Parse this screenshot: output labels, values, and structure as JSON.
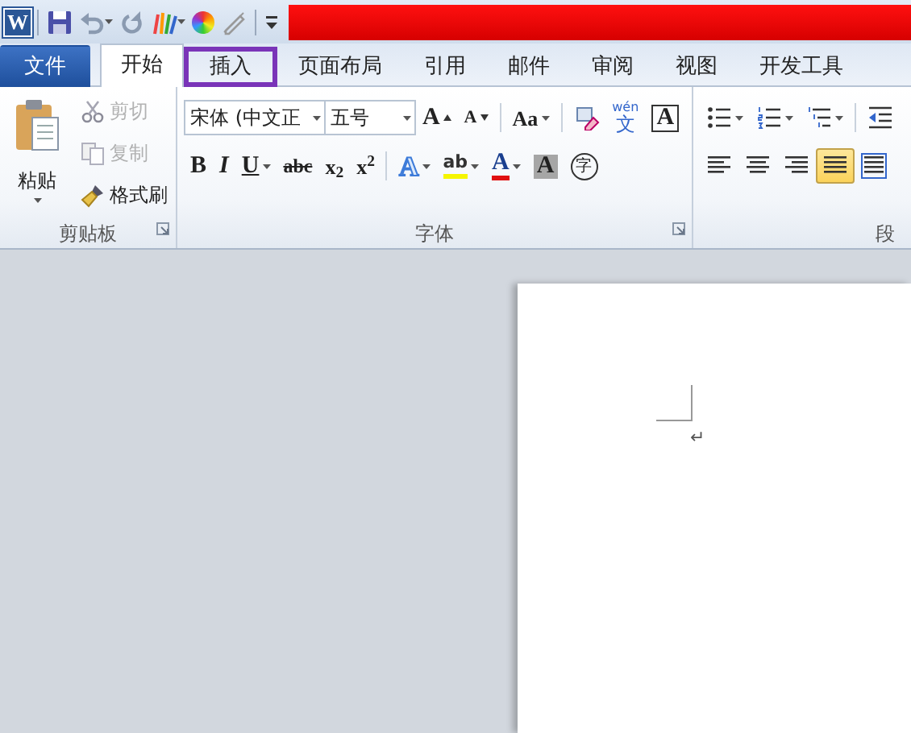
{
  "quick_access": {
    "app_letter": "W",
    "tools": [
      {
        "kind": "save",
        "dropdown": false
      },
      {
        "kind": "undo",
        "dropdown": true
      },
      {
        "kind": "redo",
        "dropdown": false
      },
      {
        "kind": "brushes",
        "dropdown": true
      },
      {
        "kind": "colorwheel",
        "dropdown": false
      },
      {
        "kind": "pen",
        "dropdown": false
      },
      {
        "kind": "customize",
        "dropdown": false
      }
    ]
  },
  "tabs": [
    {
      "label": "文件",
      "kind": "file",
      "selected": false,
      "annotated": false
    },
    {
      "label": "开始",
      "kind": "tab",
      "selected": true,
      "annotated": false
    },
    {
      "label": "插入",
      "kind": "tab",
      "selected": false,
      "annotated": true
    },
    {
      "label": "页面布局",
      "kind": "tab",
      "selected": false,
      "annotated": false
    },
    {
      "label": "引用",
      "kind": "tab",
      "selected": false,
      "annotated": false
    },
    {
      "label": "邮件",
      "kind": "tab",
      "selected": false,
      "annotated": false
    },
    {
      "label": "审阅",
      "kind": "tab",
      "selected": false,
      "annotated": false
    },
    {
      "label": "视图",
      "kind": "tab",
      "selected": false,
      "annotated": false
    },
    {
      "label": "开发工具",
      "kind": "tab",
      "selected": false,
      "annotated": false
    }
  ],
  "clipboard": {
    "title": "剪贴板",
    "paste": {
      "label": "粘贴",
      "dropdown": true
    },
    "actions": [
      {
        "kind": "cut",
        "label": "剪切",
        "disabled": true
      },
      {
        "kind": "copy",
        "label": "复制",
        "disabled": true
      },
      {
        "kind": "painter",
        "label": "格式刷",
        "disabled": false
      }
    ]
  },
  "font": {
    "title": "字体",
    "font_name": "宋体 (中文正",
    "font_size": "五号",
    "row1": [
      {
        "kind": "grow",
        "label": "A",
        "dropdown": false
      },
      {
        "kind": "shrink",
        "label": "A",
        "dropdown": false
      },
      {
        "kind": "sep"
      },
      {
        "kind": "case",
        "label": "Aa",
        "dropdown": true
      },
      {
        "kind": "sep"
      },
      {
        "kind": "clear",
        "dropdown": false
      },
      {
        "kind": "phonetic",
        "label": "wén",
        "sub": "文",
        "dropdown": false
      },
      {
        "kind": "border",
        "label": "A",
        "dropdown": false
      }
    ],
    "row2": [
      {
        "kind": "bold",
        "label": "B",
        "dropdown": false
      },
      {
        "kind": "italic",
        "label": "I",
        "dropdown": false
      },
      {
        "kind": "underline",
        "label": "U",
        "dropdown": true
      },
      {
        "kind": "strike",
        "label": "abc",
        "dropdown": false
      },
      {
        "kind": "subscript",
        "label": "x$_{2}$",
        "dropdown": false
      },
      {
        "kind": "superscript",
        "label": "x$^{2}$",
        "dropdown": false
      },
      {
        "kind": "sep"
      },
      {
        "kind": "effects",
        "label": "A",
        "dropdown": true
      },
      {
        "kind": "highlight",
        "label": "ab",
        "dropdown": true
      },
      {
        "kind": "fontcolor",
        "label": "A",
        "dropdown": true
      },
      {
        "kind": "shading",
        "label": "A",
        "dropdown": false
      },
      {
        "kind": "enclose",
        "label": "字",
        "dropdown": false
      }
    ]
  },
  "paragraph": {
    "title": "段",
    "row1": [
      {
        "kind": "bullets",
        "dropdown": true,
        "selected": false
      },
      {
        "kind": "numbering",
        "dropdown": true,
        "selected": false
      },
      {
        "kind": "multilevel",
        "dropdown": true,
        "selected": false
      },
      {
        "kind": "sep"
      },
      {
        "kind": "indent",
        "dropdown": false,
        "selected": false
      }
    ],
    "row2": [
      {
        "kind": "left",
        "dropdown": false,
        "selected": false
      },
      {
        "kind": "center",
        "dropdown": false,
        "selected": false
      },
      {
        "kind": "right",
        "dropdown": false,
        "selected": false
      },
      {
        "kind": "justify",
        "dropdown": false,
        "selected": true
      },
      {
        "kind": "distribute",
        "dropdown": false,
        "selected": false
      }
    ]
  },
  "document": {
    "paragraph_mark": "↵"
  }
}
